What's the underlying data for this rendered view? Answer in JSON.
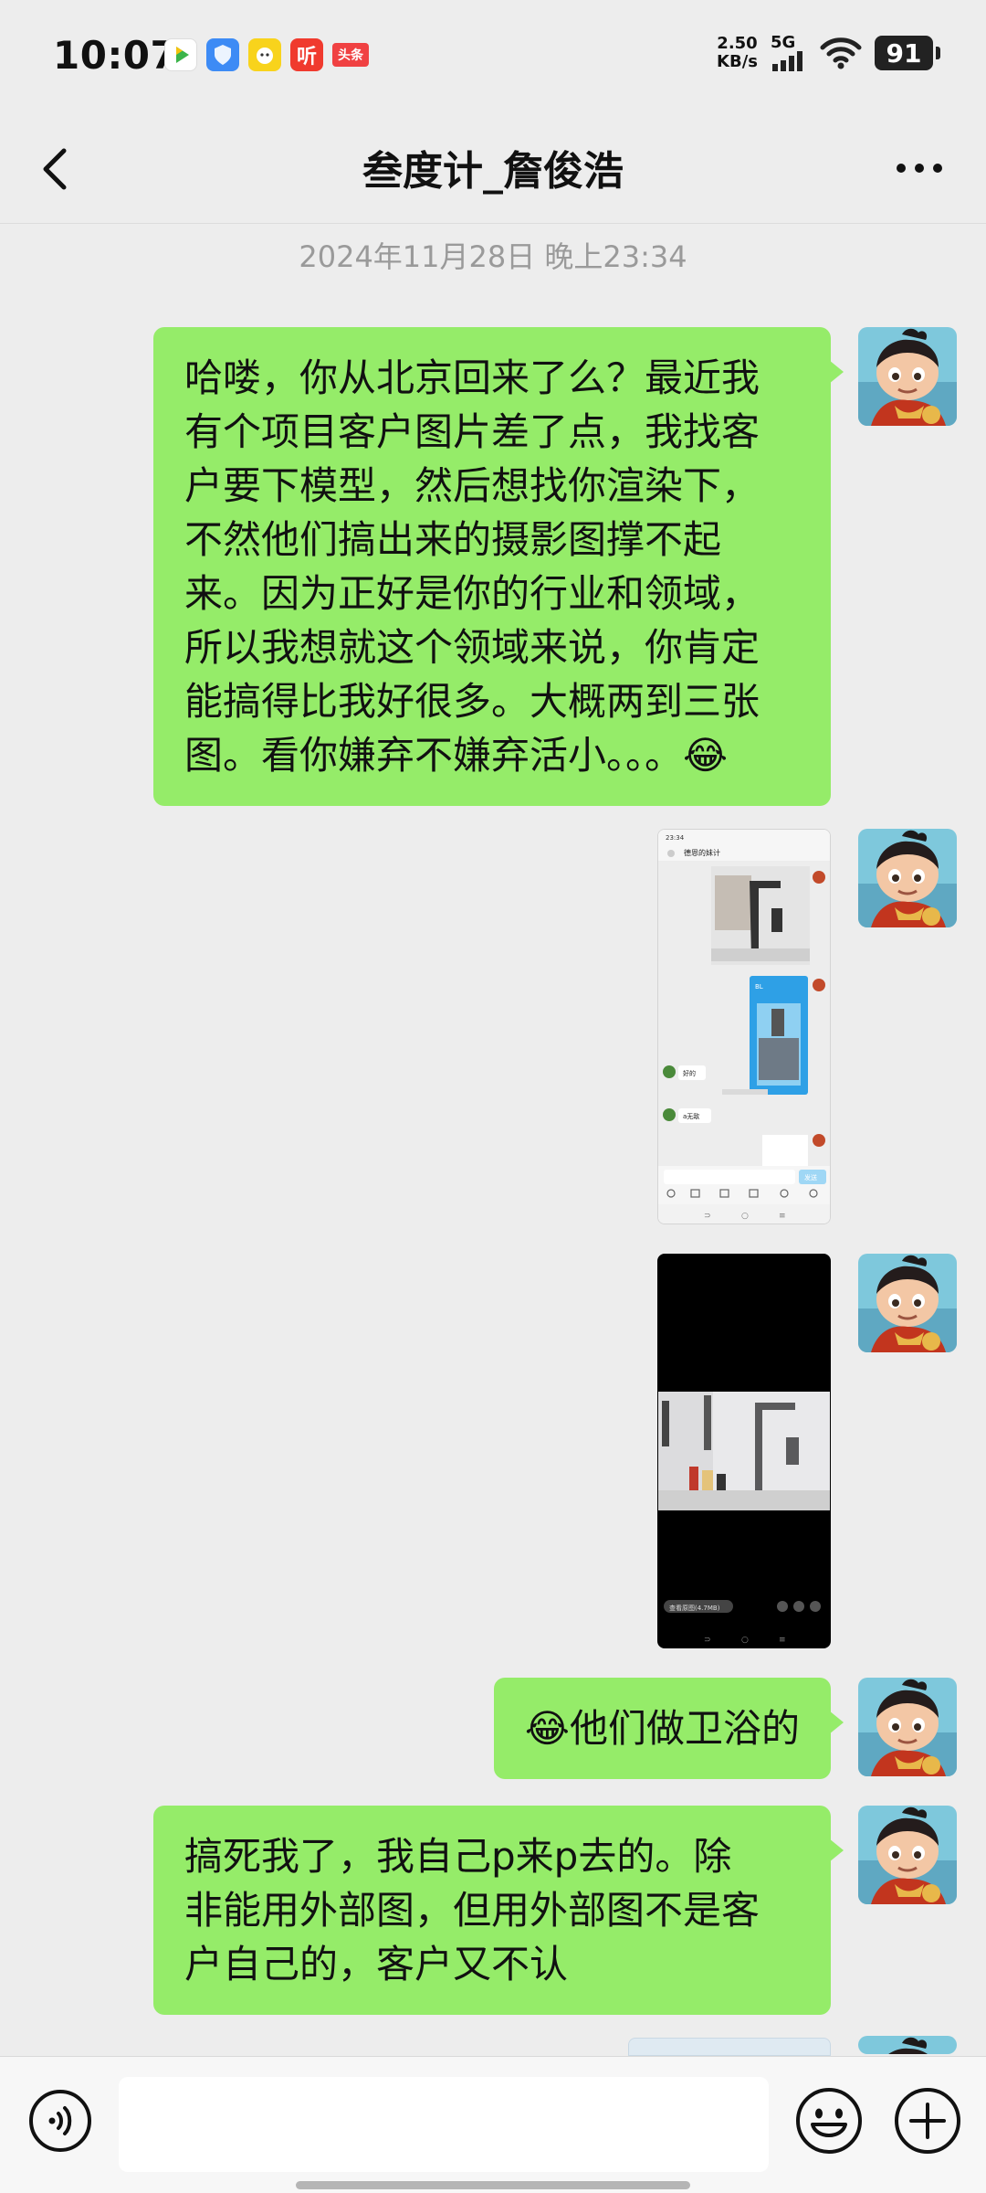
{
  "status_bar": {
    "time": "10:07",
    "apps": [
      {
        "icon": "video-app-icon",
        "label": "",
        "color": "#ffffff"
      },
      {
        "icon": "shield-app-icon",
        "label": "",
        "color": "#3d8bf5"
      },
      {
        "icon": "yellow-app-icon",
        "label": "",
        "color": "#f8d31c"
      },
      {
        "icon": "listen-app-icon",
        "label": "听",
        "color": "#f03a2e"
      },
      {
        "icon": "toutiao-app-icon",
        "label": "头条",
        "color": "#f04142"
      }
    ],
    "net_speed_value": "2.50",
    "net_speed_unit": "KB/s",
    "network": "5G",
    "battery": "91"
  },
  "nav": {
    "title": "叁度计_詹俊浩"
  },
  "timestamp": "2024年11月28日 晚上23:34",
  "messages": [
    {
      "type": "text",
      "lines": [
        "哈喽，你从北京回来了么？最近我",
        "有个项目客户图片差了点，我找客",
        "户要下模型，然后想找你渲染下，",
        "不然他们搞出来的摄影图撑不起",
        "来。因为正好是你的行业和领域，",
        "所以我想就这个领域来说，你肯定",
        "能搞得比我好很多。大概两到三张",
        "图。看你嫌弃不嫌弃活小。。。😂"
      ]
    },
    {
      "type": "image",
      "description": "chat-screenshot-image",
      "inner_texts": {
        "time": "23:34",
        "chat_title": "德恩的妹计",
        "reply1": "好的",
        "reply2": "a无敌",
        "send": "发送"
      }
    },
    {
      "type": "image",
      "description": "faucet-photo-image",
      "inner_texts": {
        "view_original": "查看原图(4.7MB)"
      }
    },
    {
      "type": "text",
      "lines": [
        "😂他们做卫浴的"
      ]
    },
    {
      "type": "text",
      "lines": [
        "搞死我了，我自己p来p去的。除",
        "非能用外部图，但用外部图不是客",
        "户自己的，客户又不认"
      ]
    }
  ],
  "input_bar": {
    "voice_icon": "voice-icon",
    "emoji_icon": "emoji-icon",
    "plus_icon": "plus-icon"
  },
  "colors": {
    "bubble": "#95ec69",
    "background": "#ededed"
  }
}
